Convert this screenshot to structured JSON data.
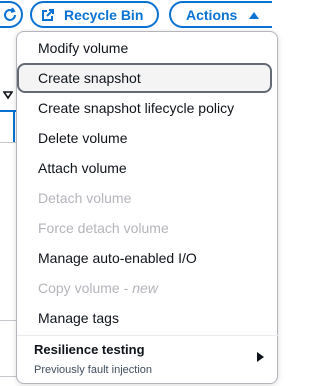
{
  "toolbar": {
    "recycle_bin_label": "Recycle Bin",
    "actions_label": "Actions"
  },
  "menu": {
    "items": [
      {
        "label": "Modify volume",
        "disabled": false
      },
      {
        "label": "Create snapshot",
        "disabled": false,
        "highlighted": true
      },
      {
        "label": "Create snapshot lifecycle policy",
        "disabled": false
      },
      {
        "label": "Delete volume",
        "disabled": false
      },
      {
        "label": "Attach volume",
        "disabled": false
      },
      {
        "label": "Detach volume",
        "disabled": true
      },
      {
        "label": "Force detach volume",
        "disabled": true
      },
      {
        "label": "Manage auto-enabled I/O",
        "disabled": false
      },
      {
        "label": "Copy volume -",
        "tag": "new",
        "disabled": true
      },
      {
        "label": "Manage tags",
        "disabled": false
      }
    ],
    "group": {
      "title": "Resilience testing",
      "subtitle": "Previously fault injection"
    }
  },
  "colors": {
    "accent": "#0972d3",
    "text": "#0f141a",
    "disabled": "#b4b4bb"
  }
}
